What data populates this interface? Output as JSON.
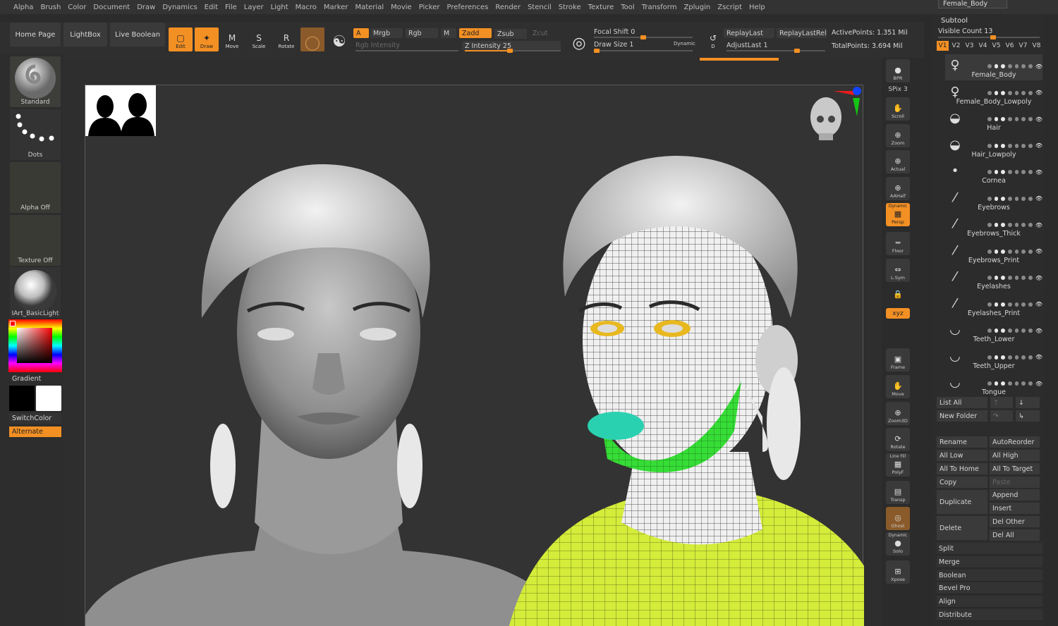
{
  "menu": [
    "Alpha",
    "Brush",
    "Color",
    "Document",
    "Draw",
    "Dynamics",
    "Edit",
    "File",
    "Layer",
    "Light",
    "Macro",
    "Marker",
    "Material",
    "Movie",
    "Picker",
    "Preferences",
    "Render",
    "Stencil",
    "Stroke",
    "Texture",
    "Tool",
    "Transform",
    "Zplugin",
    "Zscript",
    "Help"
  ],
  "subtool_tab": "Female_Body",
  "toolbar": {
    "home_page": "Home Page",
    "lightbox": "LightBox",
    "live_boolean": "Live Boolean",
    "edit": "Edit",
    "draw": "Draw",
    "move": "Move",
    "scale": "Scale",
    "rotate": "Rotate",
    "a": "A",
    "mrgb": "Mrgb",
    "rgb": "Rgb",
    "m": "M",
    "zadd": "Zadd",
    "zsub": "Zsub",
    "zcut": "Zcut",
    "rgb_intensity": "Rgb Intensity",
    "z_intensity": "Z Intensity 25",
    "z_intensity_value": 25,
    "focal_shift": "Focal Shift 0",
    "focal_shift_value": 0,
    "draw_size": "Draw Size 1",
    "dynamic": "Dynamic",
    "replay_last": "ReplayLast",
    "replay_last_rel": "ReplayLastRel",
    "adjust_last": "AdjustLast 1",
    "active_points": "ActivePoints: 1.351 Mil",
    "total_points": "TotalPoints: 3.694 Mil"
  },
  "left": {
    "standard": "Standard",
    "dots": "Dots",
    "alpha_off": "Alpha Off",
    "texture_off": "Texture Off",
    "material": "IArt_BasicLight",
    "gradient": "Gradient",
    "switch_color": "SwitchColor",
    "alternate": "Alternate"
  },
  "right_tools": [
    {
      "label": "BPR",
      "icon": "bpr-icon"
    },
    {
      "label": "SPix 3",
      "icon": "spix-icon"
    },
    {
      "label": "Scroll",
      "icon": "scroll-icon"
    },
    {
      "label": "Zoom",
      "icon": "zoom-icon"
    },
    {
      "label": "Actual",
      "icon": "actual-icon"
    },
    {
      "label": "AAHalf",
      "icon": "aahalf-icon"
    },
    {
      "label": "Persp",
      "icon": "persp-icon",
      "top": "Dynamic"
    },
    {
      "label": "Floor",
      "icon": "floor-icon"
    },
    {
      "label": "L.Sym",
      "icon": "lsym-icon"
    },
    {
      "label": "",
      "icon": "lock-icon"
    },
    {
      "label": "xyz",
      "icon": "xyz-icon"
    },
    {
      "label": "Frame",
      "icon": "frame-icon"
    },
    {
      "label": "Move",
      "icon": "move-icon"
    },
    {
      "label": "Zoom3D",
      "icon": "zoom3d-icon"
    },
    {
      "label": "Rotate",
      "icon": "rotate-icon"
    },
    {
      "label": "PolyF",
      "icon": "polyf-icon",
      "top": "Line Fill"
    },
    {
      "label": "Transp",
      "icon": "transp-icon"
    },
    {
      "label": "Ghost",
      "icon": "ghost-icon"
    },
    {
      "label": "Solo",
      "icon": "solo-icon",
      "top": "Dynamic"
    },
    {
      "label": "Xpose",
      "icon": "xpose-icon"
    }
  ],
  "subtool": {
    "title": "Subtool",
    "visible_count": "Visible Count 13",
    "versions": [
      "V1",
      "V2",
      "V3",
      "V4",
      "V5",
      "V6",
      "V7",
      "V8"
    ],
    "items": [
      "Female_Body",
      "Female_Body_Lowpoly",
      "Hair",
      "Hair_Lowpoly",
      "Cornea",
      "Eyebrows",
      "Eyebrows_Thick",
      "Eyebrows_Print",
      "Eyelashes",
      "Eyelashes_Print",
      "Teeth_Lower",
      "Teeth_Upper",
      "Tongue"
    ],
    "list_all": "List All",
    "new_folder": "New Folder",
    "rename": "Rename",
    "auto_reorder": "AutoReorder",
    "all_low": "All Low",
    "all_high": "All High",
    "all_to_home": "All To Home",
    "all_to_target": "All To Target",
    "copy": "Copy",
    "paste": "Paste",
    "append": "Append",
    "duplicate": "Duplicate",
    "insert": "Insert",
    "delete": "Delete",
    "del_other": "Del Other",
    "del_all": "Del All",
    "split": "Split",
    "merge": "Merge",
    "boolean": "Boolean",
    "bevel_pro": "Bevel Pro",
    "align": "Align",
    "distribute": "Distribute"
  },
  "colors": {
    "accent": "#f39024",
    "poly_green": "#33dd33",
    "poly_yellow": "#d4ec3a",
    "poly_teal": "#2ad1b0",
    "eye_yellow": "#e8b820"
  }
}
